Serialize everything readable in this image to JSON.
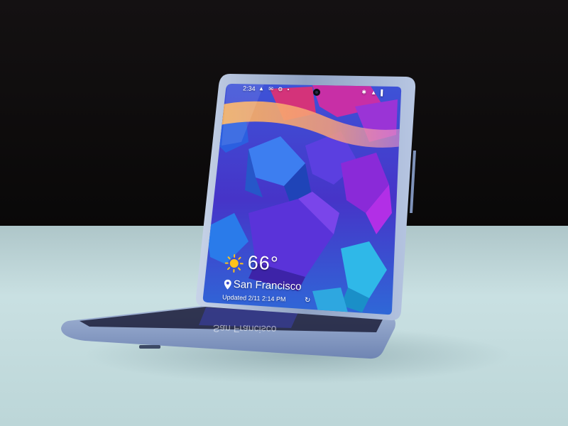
{
  "status_bar": {
    "time": "2:34",
    "left_icons": "▲ ✉ ⚙ •",
    "right_icons": "✱ ▲ ▌"
  },
  "weather_widget": {
    "temperature": "66°",
    "location": "San Francisco",
    "updated": "Updated 2/11 2:14 PM",
    "refresh_glyph": "↻",
    "sun_icon": "sun-icon",
    "pin_icon": "location-pin-icon"
  },
  "reflection": {
    "location": "San Francisco"
  },
  "colors": {
    "background_top": "#0d0b0c",
    "table_surface": "#c5dde0",
    "phone_frame": "#9fb3cf",
    "wallpaper_blue": "#2e5fd6",
    "wallpaper_purple": "#7a2fe0",
    "wallpaper_cyan": "#2fb5e6",
    "wallpaper_orange": "#f3a955"
  }
}
